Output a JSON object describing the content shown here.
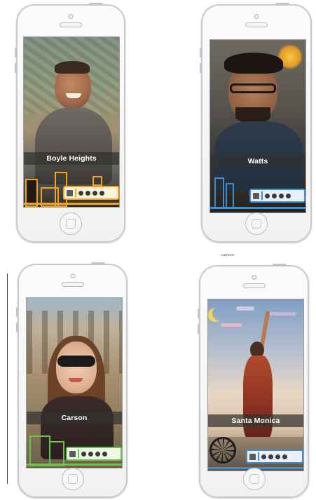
{
  "page": {
    "small_tag": "capture"
  },
  "phones": [
    {
      "caption": "Boyle Heights",
      "theme_color": "#f2a31b"
    },
    {
      "caption": "Watts",
      "theme_color": "#3f8ed0"
    },
    {
      "caption": "Carson",
      "theme_color": "#6bc34a"
    },
    {
      "caption": "Santa Monica",
      "theme_color": "#3f8ed0"
    }
  ],
  "icons": [
    "speaker-icon",
    "camera-icon",
    "home-button-icon",
    "building-icon",
    "ferris-wheel-icon",
    "moon-icon",
    "sun-icon"
  ]
}
